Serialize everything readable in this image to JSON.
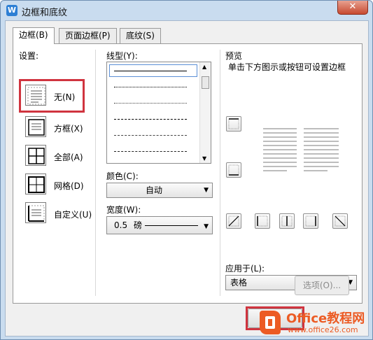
{
  "window": {
    "title": "边框和底纹",
    "app_icon": "W",
    "close_glyph": "✕"
  },
  "tabs": [
    {
      "label": "边框(B)",
      "active": true
    },
    {
      "label": "页面边框(P)",
      "active": false
    },
    {
      "label": "底纹(S)",
      "active": false
    }
  ],
  "setting": {
    "label": "设置:",
    "options": [
      {
        "label": "无(N)",
        "icon": "no-border-icon",
        "selected": true
      },
      {
        "label": "方框(X)",
        "icon": "box-border-icon"
      },
      {
        "label": "全部(A)",
        "icon": "all-borders-icon"
      },
      {
        "label": "网格(D)",
        "icon": "grid-border-icon"
      },
      {
        "label": "自定义(U)",
        "icon": "custom-border-icon"
      }
    ]
  },
  "line_style": {
    "label": "线型(Y):"
  },
  "color": {
    "label": "颜色(C):",
    "value": "自动"
  },
  "width": {
    "label": "宽度(W):",
    "value": "0.5",
    "unit": "磅"
  },
  "preview": {
    "label": "预览",
    "hint": "单击下方图示或按钮可设置边框",
    "apply_label": "应用于(L):",
    "apply_value": "表格",
    "options_button": "选项(O)..."
  },
  "watermark": {
    "brand": "Office教程网",
    "url": "www.office26.com"
  },
  "colors": {
    "highlight": "#d0343f",
    "brand": "#ec5b24",
    "accent": "#2d7fd4"
  }
}
